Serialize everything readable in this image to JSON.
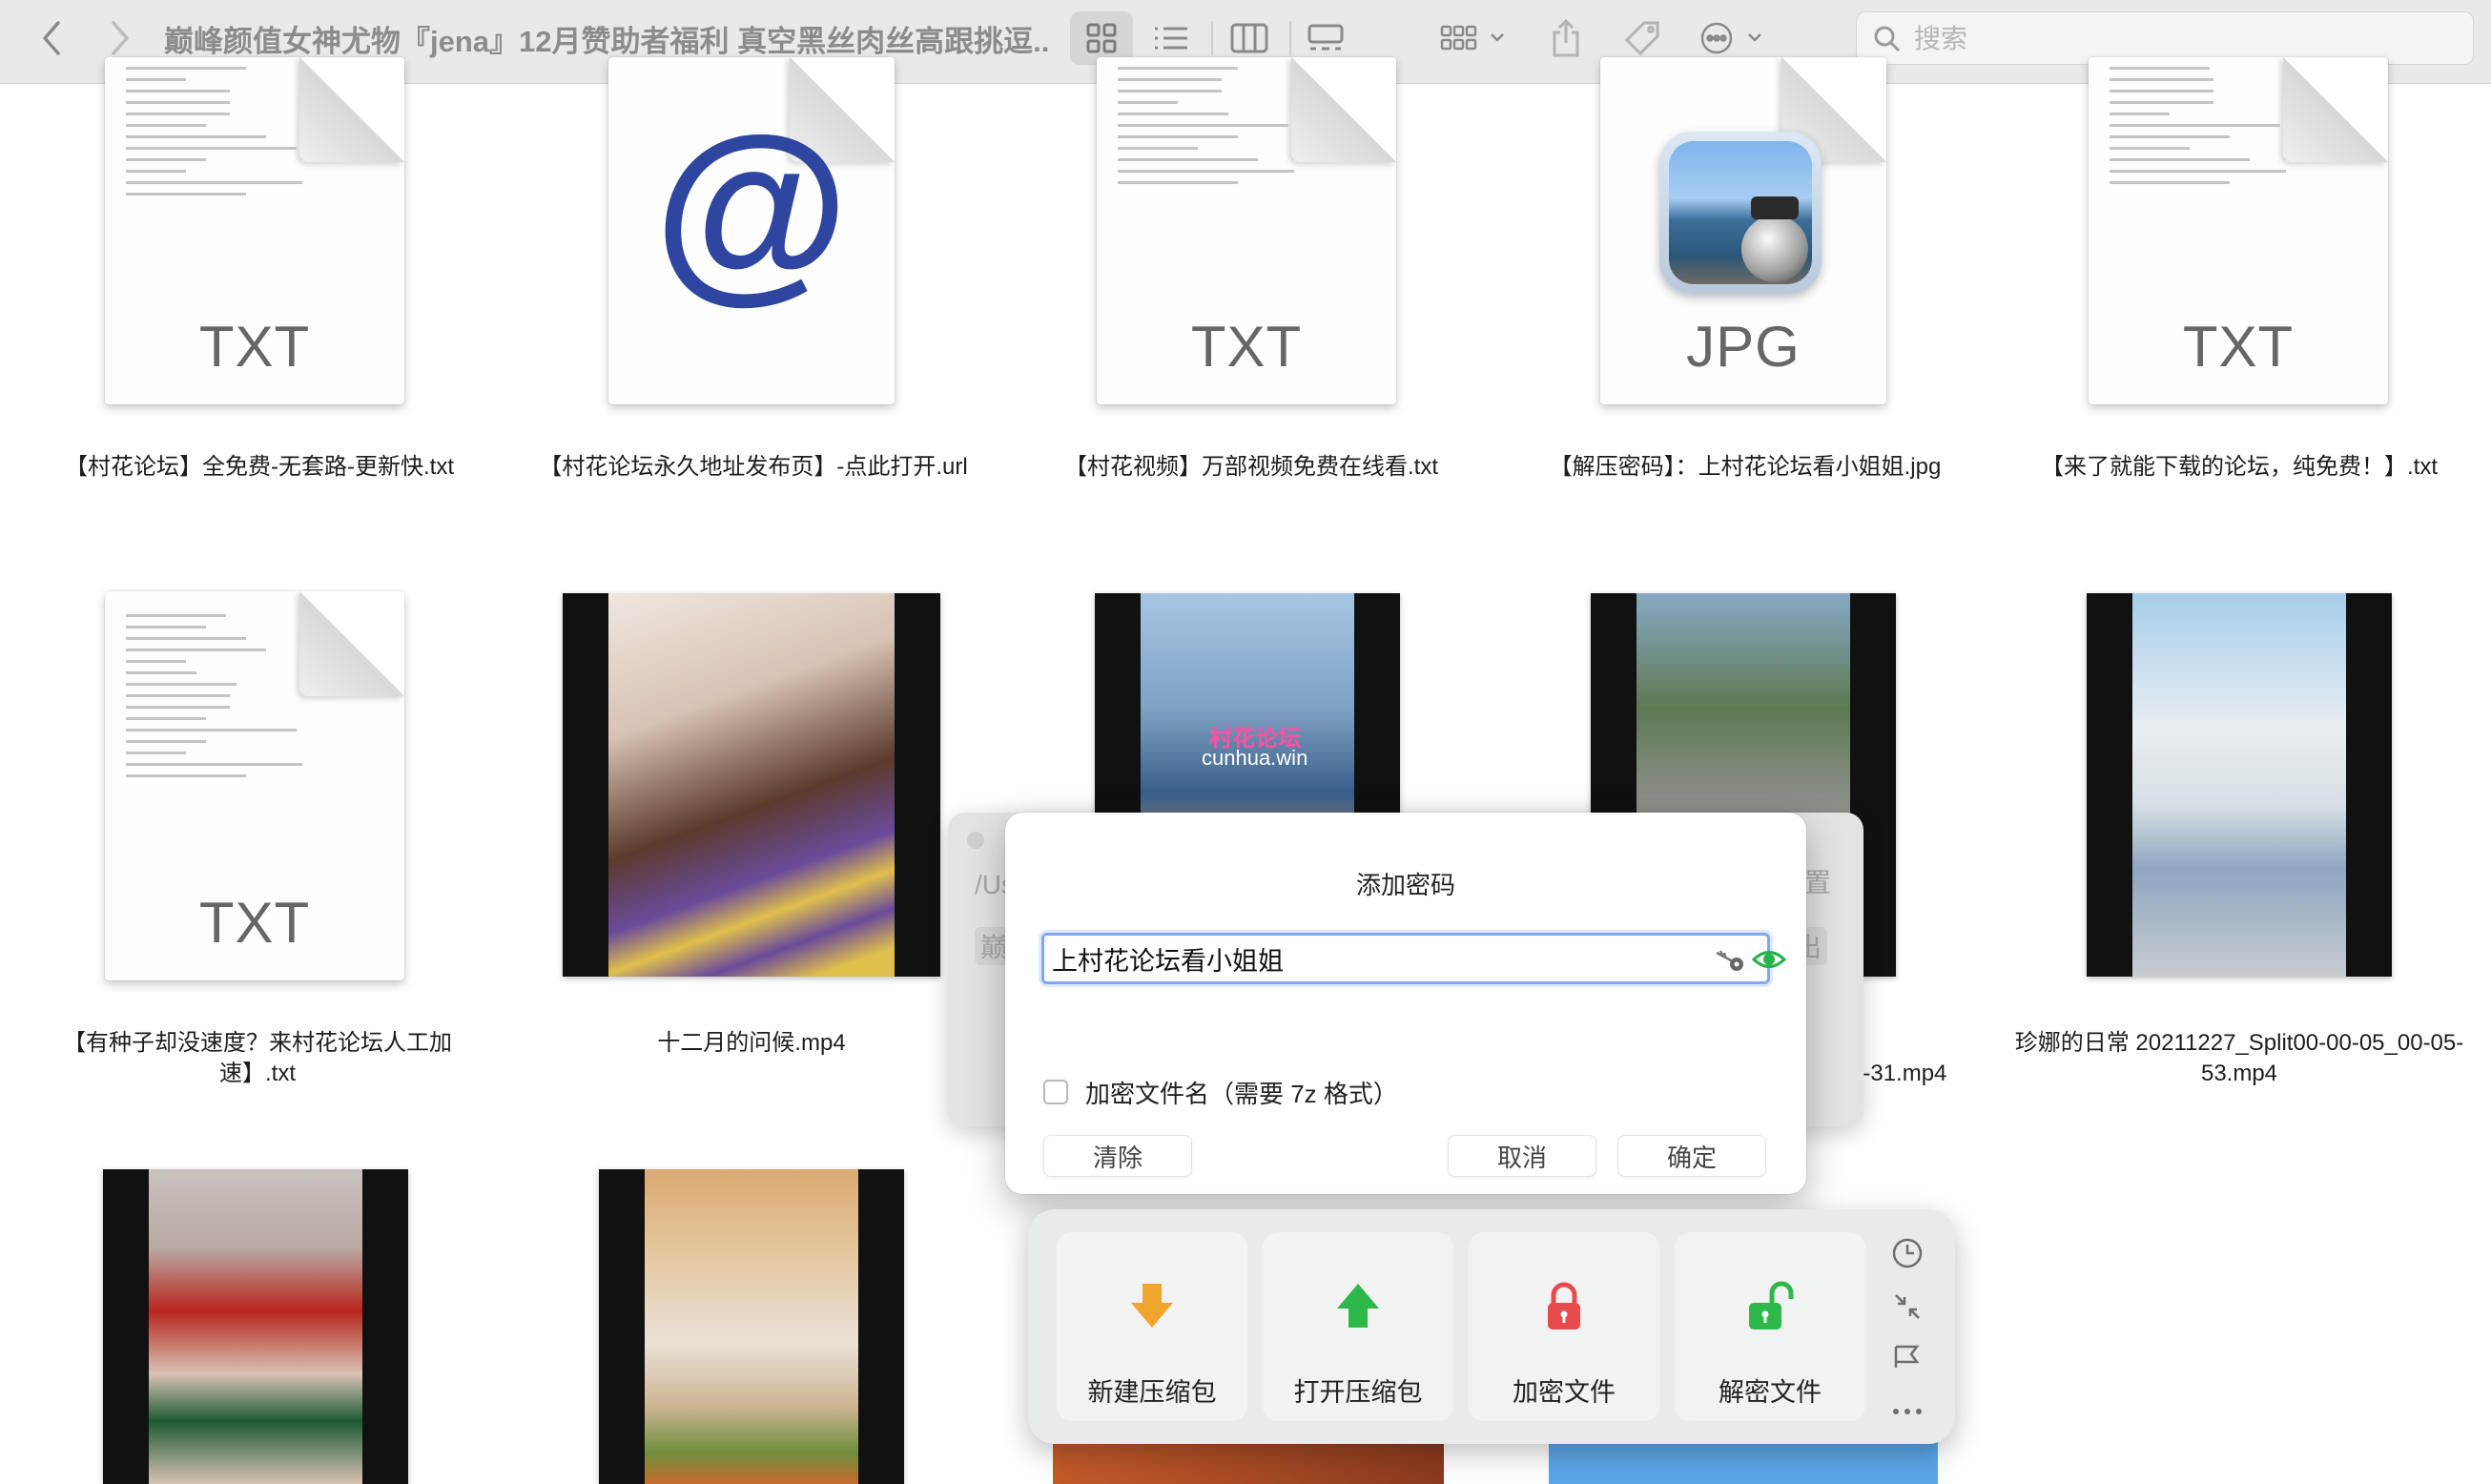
{
  "toolbar": {
    "title": "巅峰颜值女神尤物『jena』12月赞助者福利 真空黑丝肉丝高跟挑逗...",
    "search_placeholder": "搜索"
  },
  "files": [
    {
      "name": "【村花论坛】全免费-无套路-更新快.txt",
      "ext": "TXT"
    },
    {
      "name": "【村花论坛永久地址发布页】-点此打开.url",
      "ext": "@"
    },
    {
      "name": "【村花视频】万部视频免费在线看.txt",
      "ext": "TXT"
    },
    {
      "name": "【解压密码】：上村花论坛看小姐姐.jpg",
      "ext": "JPG"
    },
    {
      "name": "【来了就能下载的论坛，纯免费！】.txt",
      "ext": "TXT"
    },
    {
      "name": "【有种子却没速度？来村花论坛人工加速】.txt",
      "ext": "TXT"
    },
    {
      "name": "十二月的问候.mp4"
    },
    {
      "name": "3-31.mp4"
    },
    {
      "name": "珍娜的日常 20211227_Split00-00-05_00-05-53.mp4"
    }
  ],
  "watermark": {
    "brand": "村花论坛",
    "domain": "cunhua.win"
  },
  "bg_dialog": {
    "path": "/Us",
    "left_char": "巅",
    "right_char1": "置",
    "right_char2": "出"
  },
  "dialog": {
    "title": "添加密码",
    "password": "上村花论坛看小姐姐",
    "checkbox_label": "加密文件名（需要 7z 格式）",
    "clear": "清除",
    "cancel": "取消",
    "ok": "确定"
  },
  "actions": [
    {
      "label": "新建压缩包",
      "icon": "download-arrow-icon",
      "color": "#f0a52c"
    },
    {
      "label": "打开压缩包",
      "icon": "upload-arrow-icon",
      "color": "#2fb84a"
    },
    {
      "label": "加密文件",
      "icon": "lock-icon",
      "color": "#e84b4b"
    },
    {
      "label": "解密文件",
      "icon": "unlock-icon",
      "color": "#2fb84a"
    }
  ],
  "colors": {
    "accent": "#7fa8ef",
    "eye": "#27b34a"
  }
}
